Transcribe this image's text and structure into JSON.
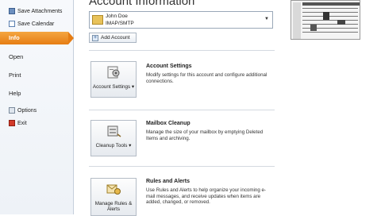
{
  "nav": {
    "save_attachments": "Save Attachments",
    "save_calendar": "Save Calendar",
    "info": "Info",
    "open": "Open",
    "print": "Print",
    "help": "Help",
    "options": "Options",
    "exit": "Exit"
  },
  "main": {
    "title": "Account Information",
    "account": {
      "name": "John Doe",
      "type": "IMAP/SMTP"
    },
    "add_account": "Add Account",
    "sections": [
      {
        "button": "Account Settings ▾",
        "title": "Account Settings",
        "desc": "Modify settings for this account and configure additional connections."
      },
      {
        "button": "Cleanup Tools ▾",
        "title": "Mailbox Cleanup",
        "desc": "Manage the size of your mailbox by emptying Deleted Items and archiving."
      },
      {
        "button": "Manage Rules & Alerts",
        "title": "Rules and Alerts",
        "desc": "Use Rules and Alerts to help organize your incoming e-mail messages, and receive updates when items are added, changed, or removed."
      }
    ]
  },
  "colors": {
    "accent": "#e67d13",
    "nav_bg": "#eef2f7"
  }
}
